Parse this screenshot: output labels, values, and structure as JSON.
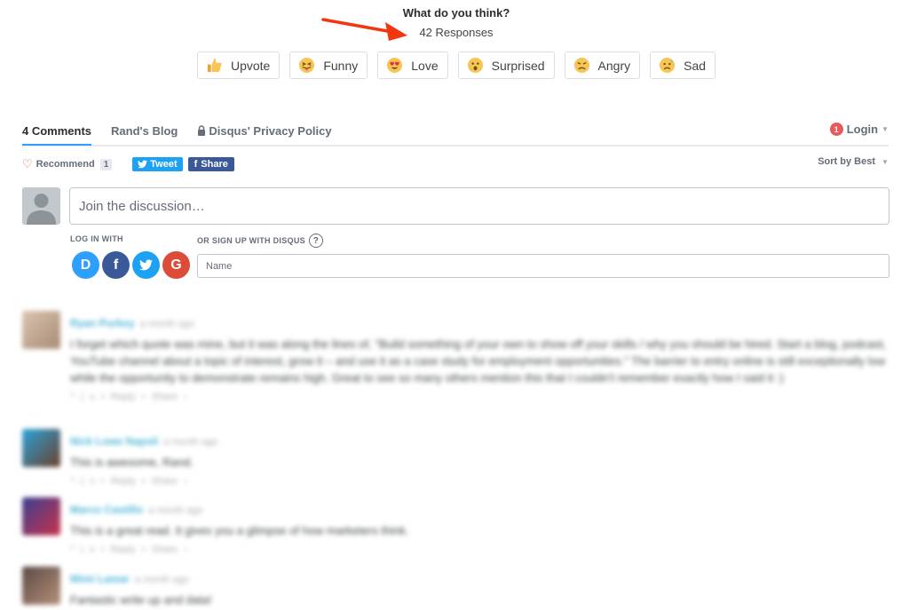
{
  "reactions_header": {
    "title": "What do you think?",
    "responses": "42 Responses"
  },
  "reactions": [
    {
      "label": "Upvote",
      "icon": "thumbs-up-emoji"
    },
    {
      "label": "Funny",
      "icon": "tongue-out-emoji"
    },
    {
      "label": "Love",
      "icon": "heart-eyes-emoji"
    },
    {
      "label": "Surprised",
      "icon": "surprised-emoji"
    },
    {
      "label": "Angry",
      "icon": "angry-emoji"
    },
    {
      "label": "Sad",
      "icon": "sad-emoji"
    }
  ],
  "tabs": {
    "comments": "4 Comments",
    "blog": "Rand's Blog",
    "privacy": "Disqus' Privacy Policy"
  },
  "login": {
    "badge": "1",
    "label": "Login"
  },
  "toolbar": {
    "recommend": "Recommend",
    "recommend_count": "1",
    "tweet": "Tweet",
    "share": "Share",
    "sort": "Sort by Best"
  },
  "compose": {
    "placeholder": "Join the discussion…",
    "login_with": "LOG IN WITH",
    "signup": "OR SIGN UP WITH DISQUS",
    "help": "?",
    "name_placeholder": "Name"
  },
  "social_logins": [
    {
      "letter": "D",
      "color": "#2e9fff",
      "icon": "disqus-icon"
    },
    {
      "letter": "f",
      "color": "#3b5998",
      "icon": "facebook-icon"
    },
    {
      "letter": "t",
      "color": "#1da1f2",
      "icon": "twitter-icon"
    },
    {
      "letter": "G",
      "color": "#dd4b39",
      "icon": "google-icon"
    }
  ],
  "comments": [
    {
      "author": "Ryan Purkey",
      "time": "a month ago",
      "text": "I forget which quote was mine, but it was along the lines of, \"Build something of your own to show off your skills / why you should be hired. Start a blog, podcast, YouTube channel about a topic of interest, grow it – and use it as a case study for employment opportunities.\" The barrier to entry online is still exceptionally low while the opportunity to demonstrate remains high. Great to see so many others mention this that I couldn't remember exactly how I said it :)",
      "actions": "^ | v • Reply • Share ›"
    },
    {
      "author": "Nick Lowe Napoli",
      "time": "a month ago",
      "text": "This is awesome, Rand.",
      "actions": "^ | v • Reply • Share ›"
    },
    {
      "author": "Marco Castillo",
      "time": "a month ago",
      "text": "This is a great read. It gives you a glimpse of how marketers think.",
      "actions": "^ | v • Reply • Share ›"
    },
    {
      "author": "Mimi Lamar",
      "time": "a month ago",
      "text": "Fantastic write up and data!",
      "actions": ""
    }
  ]
}
